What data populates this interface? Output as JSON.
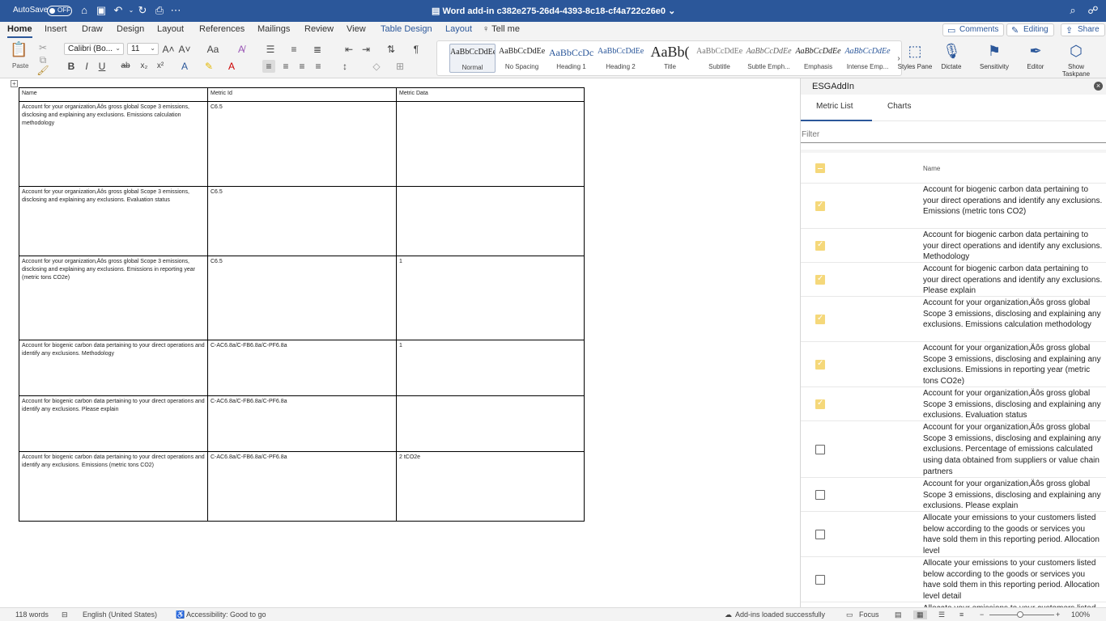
{
  "titlebar": {
    "autosave_label": "AutoSave",
    "autosave_state": "OFF",
    "document_title": "Word add-in c382e275-26d4-4393-8c18-cf4a722c26e0"
  },
  "ribbon_tabs": [
    "Home",
    "Insert",
    "Draw",
    "Design",
    "Layout",
    "References",
    "Mailings",
    "Review",
    "View",
    "Table Design",
    "Layout"
  ],
  "tell_me": "Tell me",
  "actions": {
    "comments": "Comments",
    "editing": "Editing",
    "share": "Share"
  },
  "toolbar": {
    "paste_label": "Paste",
    "font_name": "Calibri (Bo...",
    "font_size": "11",
    "styles": [
      {
        "preview": "AaBbCcDdEe",
        "name": "Normal"
      },
      {
        "preview": "AaBbCcDdEe",
        "name": "No Spacing"
      },
      {
        "preview": "AaBbCcDc",
        "name": "Heading 1"
      },
      {
        "preview": "AaBbCcDdEe",
        "name": "Heading 2"
      },
      {
        "preview": "AaBb(",
        "name": "Title"
      },
      {
        "preview": "AaBbCcDdEe",
        "name": "Subtitle"
      },
      {
        "preview": "AaBbCcDdEe",
        "name": "Subtle Emph..."
      },
      {
        "preview": "AaBbCcDdEe",
        "name": "Emphasis"
      },
      {
        "preview": "AaBbCcDdEe",
        "name": "Intense Emp..."
      }
    ],
    "styles_pane": "Styles Pane",
    "dictate": "Dictate",
    "sensitivity": "Sensitivity",
    "editor": "Editor",
    "show_taskpane": "Show Taskpane"
  },
  "document_table": {
    "headers": [
      "Name",
      "Metric Id",
      "Metric Data"
    ],
    "rows": [
      {
        "name": "Account for your organization‚Äôs gross global Scope 3 emissions, disclosing and explaining any exclusions. Emissions calculation methodology",
        "id": "C6.5",
        "data": ""
      },
      {
        "name": "Account for your organization‚Äôs gross global Scope 3 emissions, disclosing and explaining any exclusions. Evaluation status",
        "id": "C6.5",
        "data": ""
      },
      {
        "name": "Account for your organization‚Äôs gross global Scope 3 emissions, disclosing and explaining any exclusions. Emissions in reporting year (metric tons CO2e)",
        "id": "C6.5",
        "data": "1"
      },
      {
        "name": "Account for biogenic carbon data pertaining to your direct operations and identify any exclusions. Methodology",
        "id": "C-AC6.8a/C-FB6.8a/C-PF6.8a",
        "data": "1"
      },
      {
        "name": "Account for biogenic carbon data pertaining to your direct operations and identify any exclusions. Please explain",
        "id": "C-AC6.8a/C-FB6.8a/C-PF6.8a",
        "data": ""
      },
      {
        "name": "Account for biogenic carbon data pertaining to your direct operations and identify any exclusions. Emissions (metric tons CO2)",
        "id": "C-AC6.8a/C-FB6.8a/C-PF6.8a",
        "data": "2 tCO2e"
      }
    ]
  },
  "taskpane": {
    "title": "ESGAddIn",
    "tabs": [
      "Metric List",
      "Charts"
    ],
    "filter_placeholder": "Filter",
    "column_name": "Name",
    "metrics": [
      {
        "checked": true,
        "name": "Account for biogenic carbon data pertaining to your direct operations and identify any exclusions. Emissions (metric tons CO2)"
      },
      {
        "checked": true,
        "name": "Account for biogenic carbon data pertaining to your direct operations and identify any exclusions. Methodology"
      },
      {
        "checked": true,
        "name": "Account for biogenic carbon data pertaining to your direct operations and identify any exclusions. Please explain"
      },
      {
        "checked": true,
        "name": "Account for your organization‚Äôs gross global Scope 3 emissions, disclosing and explaining any exclusions. Emissions calculation methodology"
      },
      {
        "checked": true,
        "name": "Account for your organization‚Äôs gross global Scope 3 emissions, disclosing and explaining any exclusions. Emissions in reporting year (metric tons CO2e)"
      },
      {
        "checked": true,
        "name": "Account for your organization‚Äôs gross global Scope 3 emissions, disclosing and explaining any exclusions. Evaluation status"
      },
      {
        "checked": false,
        "name": "Account for your organization‚Äôs gross global Scope 3 emissions, disclosing and explaining any exclusions. Percentage of emissions calculated using data obtained from suppliers or value chain partners"
      },
      {
        "checked": false,
        "name": "Account for your organization‚Äôs gross global Scope 3 emissions, disclosing and explaining any exclusions. Please explain"
      },
      {
        "checked": false,
        "name": "Allocate your emissions to your customers listed below according to the goods or services you have sold them in this reporting period. Allocation level"
      },
      {
        "checked": false,
        "name": "Allocate your emissions to your customers listed below according to the goods or services you have sold them in this reporting period. Allocation level detail"
      },
      {
        "checked": false,
        "name": "Allocate your emissions to your customers listed below according to the goods or services you have sold them in this reporting period."
      }
    ]
  },
  "statusbar": {
    "words": "118 words",
    "language": "English (United States)",
    "accessibility": "Accessibility: Good to go",
    "addins": "Add-ins loaded successfully",
    "focus": "Focus",
    "zoom": "100%"
  },
  "colors": {
    "brand": "#2b579a",
    "checkbox_on": "#f5d87a"
  }
}
